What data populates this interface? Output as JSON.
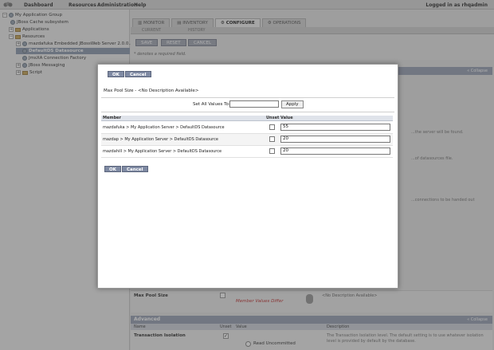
{
  "topnav": {
    "items": [
      "Dashboard",
      "Resources",
      "Administration",
      "Help"
    ],
    "user": "Logged in as rhqadmin"
  },
  "sidebar": {
    "tree": [
      {
        "label": "My Application Group",
        "toggle": "−"
      },
      {
        "label": "JBoss Cache subsystem",
        "toggle": ""
      },
      {
        "label": "Applications",
        "toggle": "+"
      },
      {
        "label": "Resources",
        "toggle": "−"
      },
      {
        "label": "mazdafuka Embedded JBossWeb Server 2.0.0...",
        "toggle": "+"
      },
      {
        "label": "DefaultDS Datasource",
        "toggle": "",
        "selected": true
      },
      {
        "label": "JmsXA Connection Factory",
        "toggle": ""
      },
      {
        "label": "JBoss Messaging",
        "toggle": "+"
      },
      {
        "label": "Script",
        "toggle": "+"
      }
    ]
  },
  "main": {
    "tabs": [
      {
        "label": "MONITOR",
        "icon": "chart-icon"
      },
      {
        "label": "INVENTORY",
        "icon": "list-icon"
      },
      {
        "label": "CONFIGURE",
        "icon": "gear-icon",
        "active": true
      },
      {
        "label": "OPERATIONS",
        "icon": "gear-icon"
      }
    ],
    "subtabs": [
      "CURRENT",
      "HISTORY"
    ],
    "actions": {
      "save": "SAVE",
      "reset": "RESET",
      "cancel": "CANCEL"
    },
    "required_note": "* denotes a required field.",
    "panel_collapse": "« Collapse",
    "bg_snippets": {
      "s1": "...the server will be found.",
      "s2": "...of datasources file.",
      "s3": "...connections to be handed out"
    },
    "max_pool": {
      "label": "Max Pool Size",
      "warning": "Member Values Differ",
      "description": "<No Description Available>"
    },
    "advanced": {
      "title": "Advanced",
      "columns": [
        "Name",
        "Unset",
        "Value",
        "Description"
      ],
      "row_label": "Transaction Isolation",
      "option": "Read Uncommitted",
      "description": "The Transaction Isolation level. The default setting is to use whatever isolation level is provided by default by the database."
    }
  },
  "modal": {
    "ok": "OK",
    "cancel": "Cancel",
    "description": "Max Pool Size - <No Description Available>",
    "set_all_label": "Set All Values To:",
    "set_all_value": "",
    "apply": "Apply",
    "columns": {
      "member": "Member",
      "unset": "Unset",
      "value": "Value"
    },
    "rows": [
      {
        "member": "mazdafuka > My Application Server > DefaultDS Datasource",
        "value": "55"
      },
      {
        "member": "mazdap > My Application Server > DefaultDS Datasource",
        "value": "20"
      },
      {
        "member": "mazdahill > My Application Server > DefaultDS Datasource",
        "value": "20"
      }
    ]
  }
}
